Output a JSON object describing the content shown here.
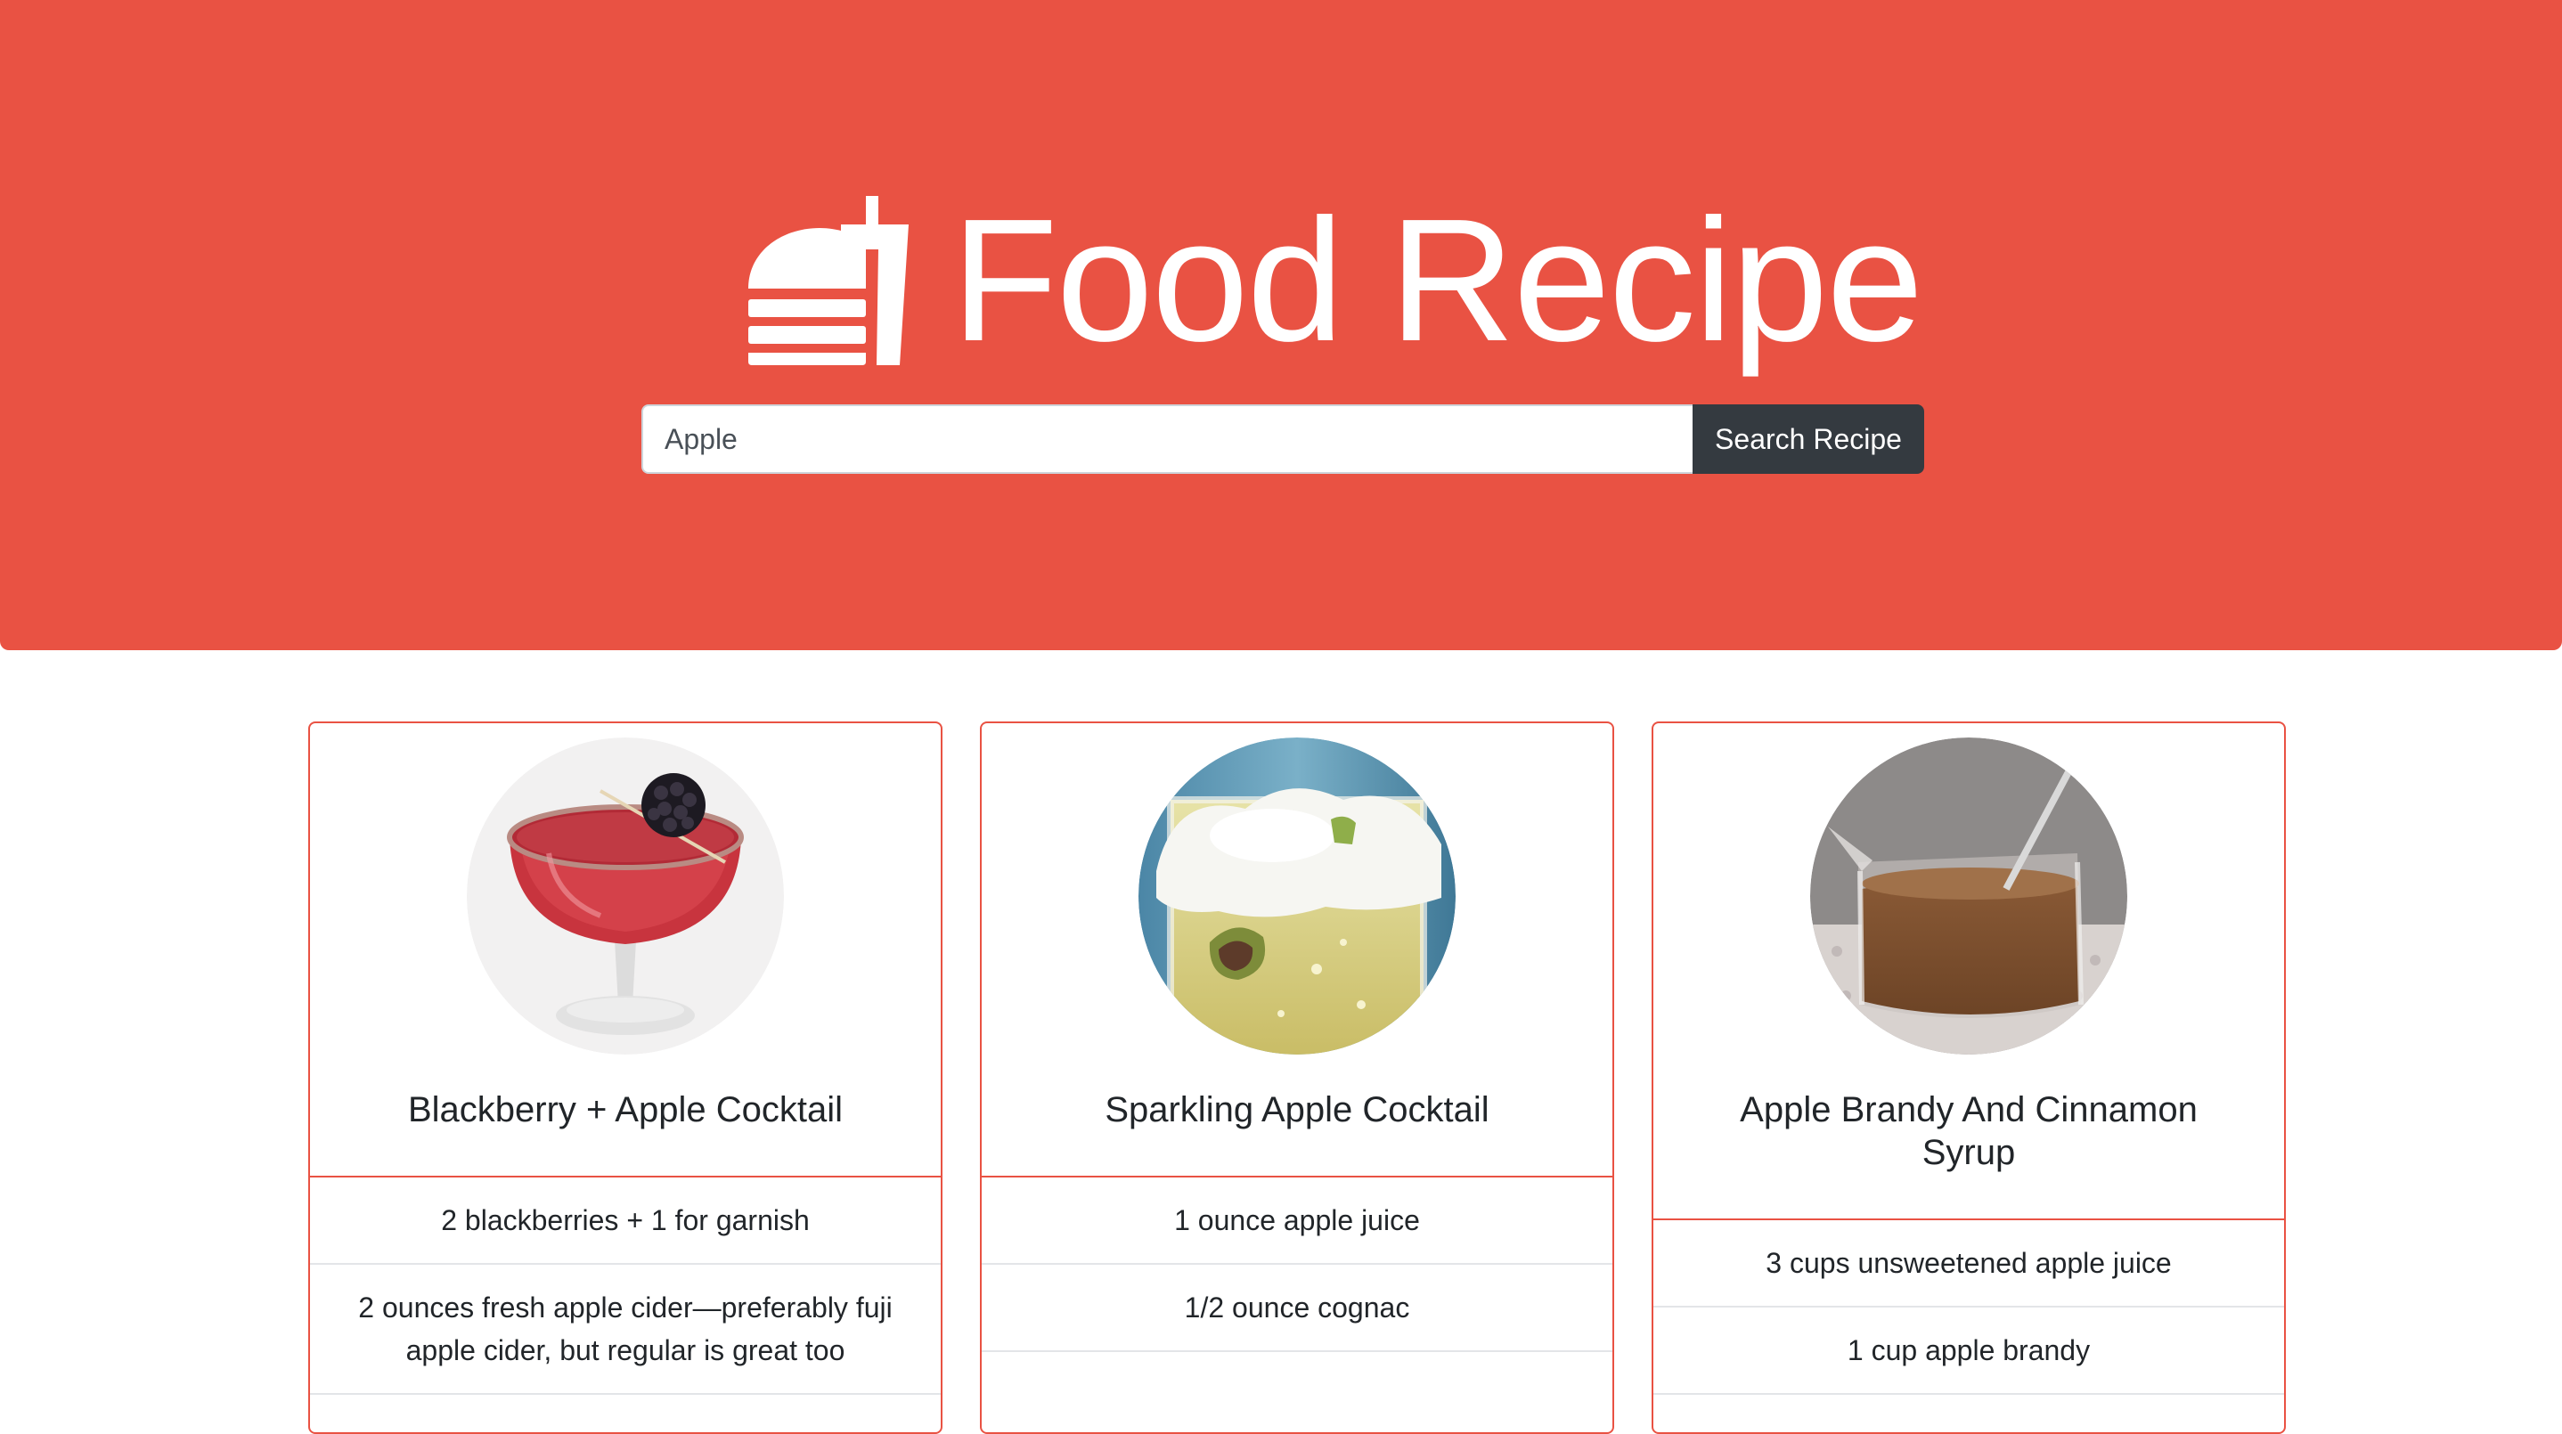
{
  "header": {
    "title": "Food Recipe",
    "logo_icon": "burger-and-drink-icon",
    "background_color": "#e95243"
  },
  "search": {
    "value": "Apple",
    "placeholder": "",
    "button_label": "Search Recipe"
  },
  "recipes": [
    {
      "title": "Blackberry + Apple Cocktail",
      "image_icon": "cocktail-glass-blackberry-image",
      "ingredients": [
        "2 blackberries + 1 for garnish",
        "2 ounces fresh apple cider—preferably fuji apple cider, but regular is great too"
      ]
    },
    {
      "title": "Sparkling Apple Cocktail",
      "image_icon": "sparkling-cocktail-image",
      "ingredients": [
        "1 ounce apple juice",
        "1/2 ounce cognac"
      ]
    },
    {
      "title": "Apple Brandy And Cinnamon Syrup",
      "image_icon": "syrup-pitcher-image",
      "ingredients": [
        "3 cups unsweetened apple juice",
        "1 cup apple brandy"
      ]
    }
  ],
  "colors": {
    "accent": "#e95243",
    "button": "#343a40"
  }
}
